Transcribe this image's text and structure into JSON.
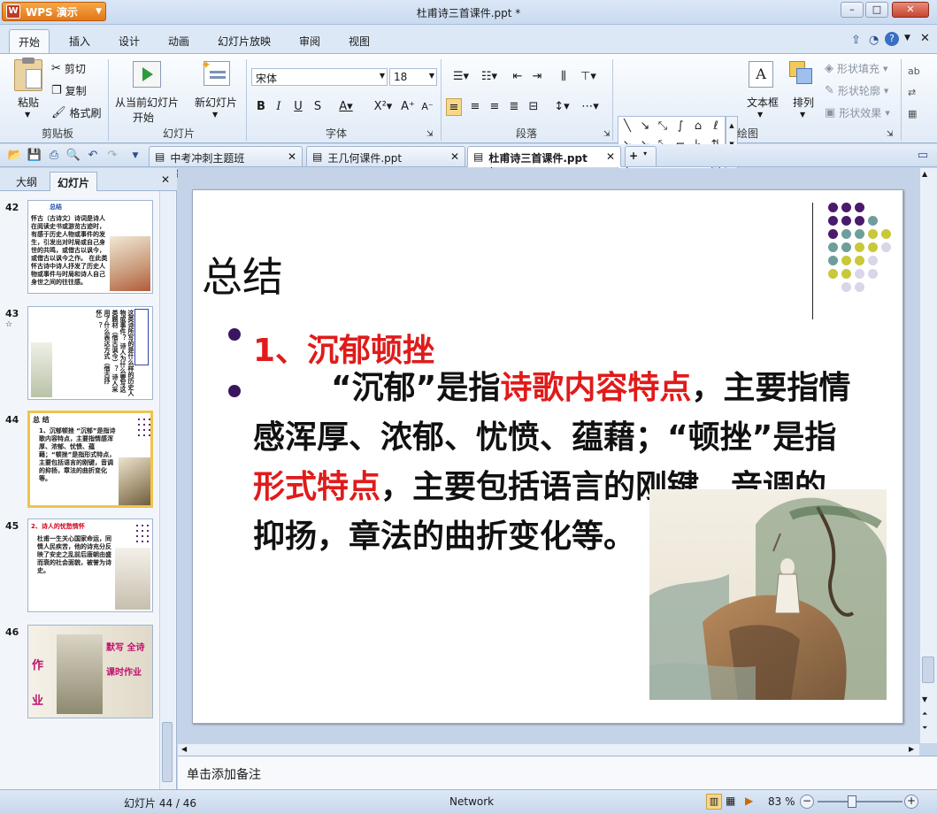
{
  "titlebar": {
    "app_name": "WPS 演示",
    "app_logo": "W",
    "document_title": "杜甫诗三首课件.ppt *",
    "min": "–",
    "max": "□",
    "close": "✕"
  },
  "ribbon_tabs": [
    "开始",
    "插入",
    "设计",
    "动画",
    "幻灯片放映",
    "审阅",
    "视图"
  ],
  "ribbon": {
    "clipboard": {
      "paste": "粘贴",
      "cut": "剪切",
      "copy": "复制",
      "format_painter": "格式刷",
      "group": "剪贴板"
    },
    "slides": {
      "from_current": "从当前幻灯片",
      "start": "开始",
      "new_slide": "新幻灯片",
      "group": "幻灯片"
    },
    "font": {
      "name": "宋体",
      "size": "18",
      "group": "字体"
    },
    "paragraph": {
      "group": "段落"
    },
    "drawing": {
      "textbox": "文本框",
      "arrange": "排列",
      "shape_fill": "形状填充",
      "shape_outline": "形状轮廓",
      "shape_effect": "形状效果",
      "group": "绘图"
    }
  },
  "doc_tabs": [
    {
      "name": "中考冲刺主题班会.ppt *",
      "active": false
    },
    {
      "name": "王几何课件.ppt",
      "active": false
    },
    {
      "name": "杜甫诗三首课件.ppt *",
      "active": true
    }
  ],
  "left_panel": {
    "tabs": [
      "大纲",
      "幻灯片"
    ],
    "thumbnails": [
      {
        "num": "42",
        "title": "总结",
        "text": "怀古（古诗文）诗词是诗人在阅读史书或游览古迹时，有感于历史人物或事件的发生，引发出对时局或自己身世的共鸣，或借古以讽今，或借古以讽今之作。 在此类怀古诗中诗人抒发了历史人物或事件与时局和诗人自己身世之间的往往感。"
      },
      {
        "num": "43",
        "title": "",
        "text": "这类诗所写的是什么样的历史人物或事件？ 诗人为什么要写这类题材（借古讽今）？ 诗人采用了什么表达方式（借古抒怀）？"
      },
      {
        "num": "44",
        "title": "总 结",
        "text": "1、沉郁顿挫 “沉郁”是指诗歌内容特点，主要指情感浑厚、浓郁、忧愤、蕴藉；“顿挫”是指形式特点，主要包括语言的刚键，音调的抑扬，章法的曲折变化等。"
      },
      {
        "num": "45",
        "title": "2、诗人的忧愁情怀",
        "text": "杜甫一生关心国家命运，同情人民疾苦，他的诗充分反映了安史之乱前后唐朝由盛而衰的社会面貌，被誉为诗史。"
      },
      {
        "num": "46",
        "title": "作 业",
        "text": "默写 全诗 课时作业"
      }
    ]
  },
  "slide": {
    "title": "总结",
    "point1": "1、沉郁顿挫",
    "body": {
      "p1": "“沉郁”是指",
      "r1": "诗歌内容特点",
      "p2": "，主要指情感浑厚、浓郁、忧愤、蕴藉；“顿挫”是指",
      "r2": "形式特点",
      "p3": "，主要包括语言的刚键，音调的抑扬，章法的曲折变化等。"
    }
  },
  "notes_placeholder": "单击添加备注",
  "status": {
    "slide_info": "幻灯片 44 / 46",
    "theme": "Network",
    "zoom": "83 %"
  },
  "colors": {
    "accent_purple": "#4b1a6b",
    "teal": "#6e9e9c",
    "olive": "#c8c83a",
    "lavender": "#d8d6e8",
    "red_text": "#e01b1b"
  },
  "icons": [
    "paste-icon",
    "scissors-icon",
    "copy-icon",
    "brush-icon",
    "slideshow-icon",
    "new-slide-icon",
    "help-icon",
    "close-icon"
  ]
}
